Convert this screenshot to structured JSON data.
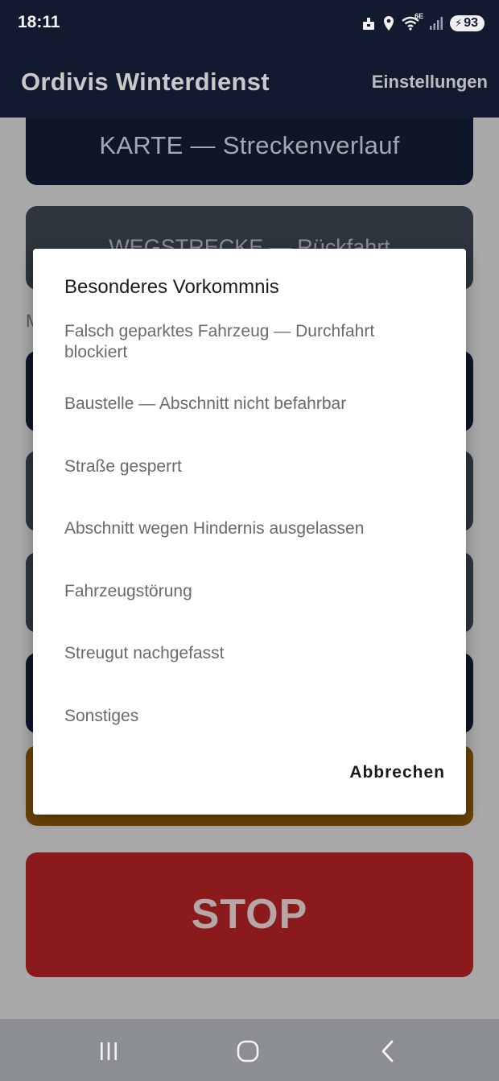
{
  "status_bar": {
    "time": "18:11",
    "network": "6E",
    "battery": "93",
    "icons": [
      "notification-icon",
      "location-icon",
      "wifi-icon",
      "signal-icon",
      "battery-icon"
    ]
  },
  "app_bar": {
    "title": "Ordivis Winterdienst",
    "settings_label": "Einstellungen"
  },
  "background": {
    "map_card_label": "KARTE — Streckenverlauf",
    "route_card_label": "WEGSTRECKE — Rückfahrt",
    "partial_section_letter": "M",
    "stop_label": "STOP"
  },
  "dialog": {
    "title": "Besonderes Vorkommnis",
    "options": [
      "Falsch geparktes Fahrzeug — Durchfahrt blockiert",
      "Baustelle — Abschnitt nicht befahrbar",
      "Straße gesperrt",
      "Abschnitt wegen Hindernis ausgelassen",
      "Fahrzeugstörung",
      "Streugut nachgefasst",
      "Sonstiges"
    ],
    "cancel_label": "Abbrechen"
  },
  "nav_bar": {
    "icons": [
      "recent-apps-icon",
      "home-icon",
      "back-icon"
    ]
  },
  "colors": {
    "app_bar": "#111a2e",
    "stop": "#8a1a1c",
    "warning": "#6b4207"
  }
}
